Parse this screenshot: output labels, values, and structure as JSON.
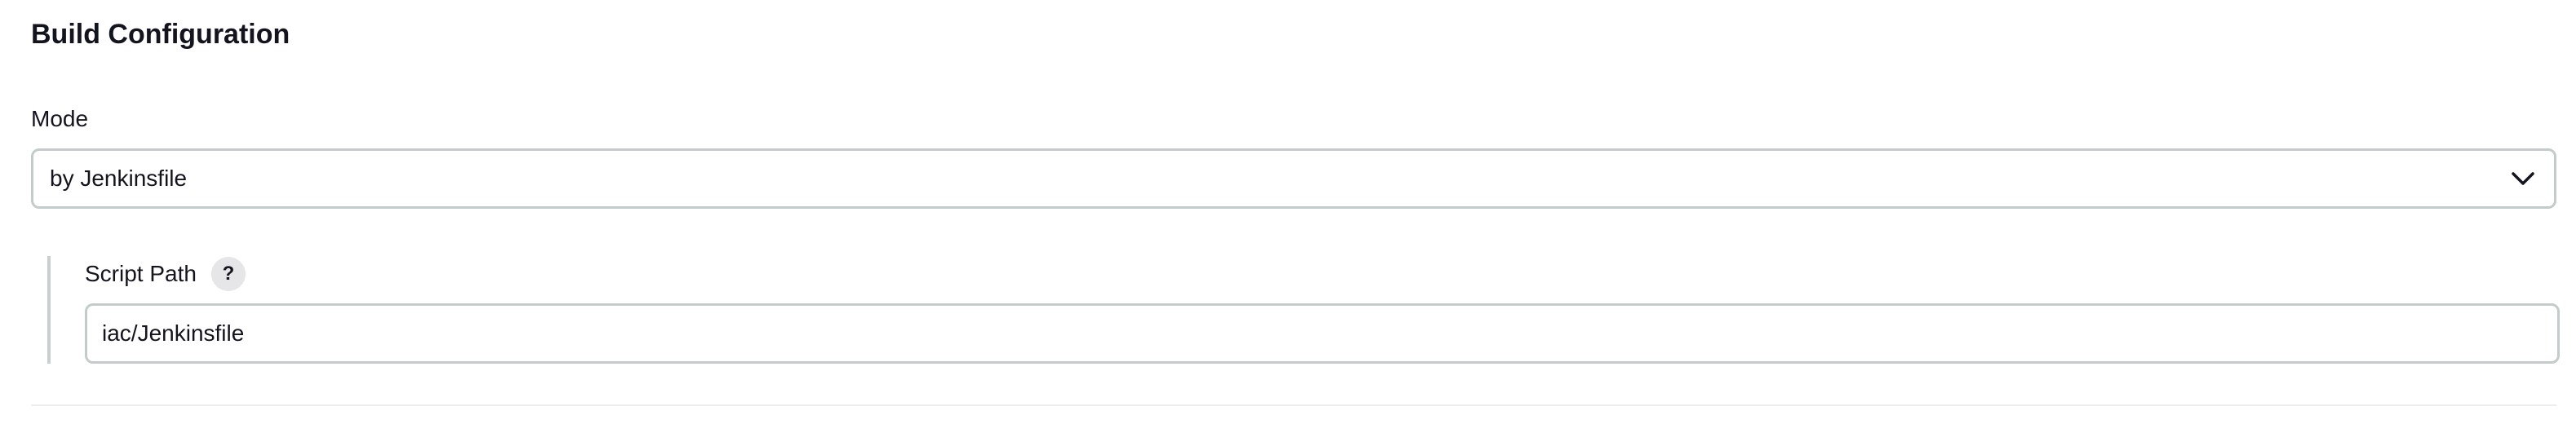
{
  "section": {
    "title": "Build Configuration"
  },
  "mode": {
    "label": "Mode",
    "selected": "by Jenkinsfile"
  },
  "script_path": {
    "label": "Script Path",
    "help": "?",
    "value": "iac/Jenkinsfile"
  },
  "icons": {
    "dropdown": "chevron-down-icon",
    "help": "question-mark-icon"
  }
}
